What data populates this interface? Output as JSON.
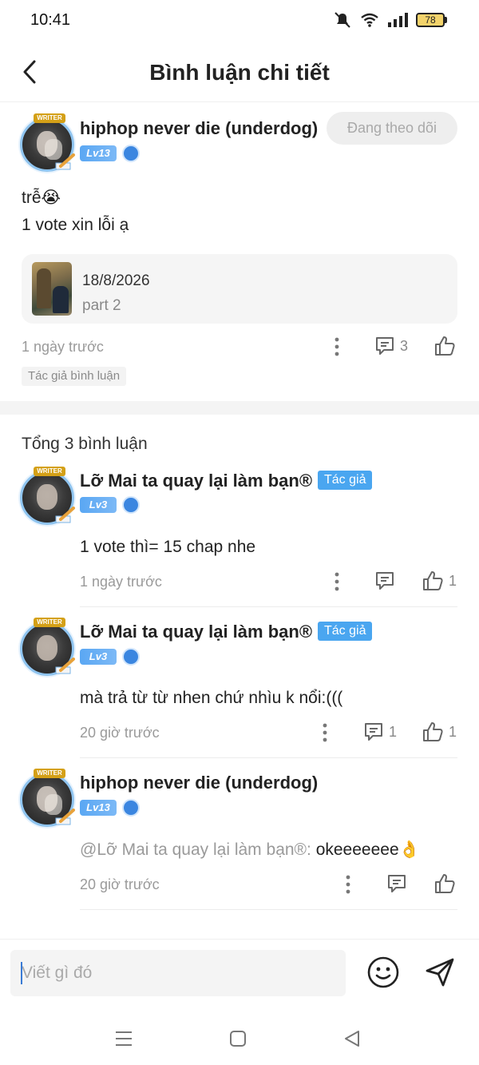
{
  "status_bar": {
    "time": "10:41",
    "battery": "78",
    "icons": [
      "mute-icon",
      "wifi-icon",
      "signal-icon",
      "battery-icon"
    ]
  },
  "header": {
    "title": "Bình luận chi tiết",
    "back_icon": "chevron-left-icon"
  },
  "main_comment": {
    "username": "hiphop never die (underdog)",
    "level": "Lv13",
    "follow_label": "Đang theo dõi",
    "text_line1": "trễ😭",
    "text_line2": "1 vote xin lỗi ạ",
    "chapter": {
      "date": "18/8/2026",
      "part": "part 2"
    },
    "time": "1 ngày trước",
    "reply_count": "3",
    "author_comment_tag": "Tác giả bình luận"
  },
  "replies_header": "Tổng 3 bình luận",
  "replies": [
    {
      "username": "Lỡ Mai ta quay lại làm bạn®",
      "level": "Lv3",
      "author_tag": "Tác giả",
      "text": "1 vote thì= 15 chap nhe",
      "time": "1 ngày trước",
      "reply_count": "",
      "like_count": "1"
    },
    {
      "username": "Lỡ Mai ta quay lại làm bạn®",
      "level": "Lv3",
      "author_tag": "Tác giả",
      "text": "mà trả từ từ nhen chứ nhìu k nổi:(((",
      "time": "20 giờ trước",
      "reply_count": "1",
      "like_count": "1"
    },
    {
      "username": "hiphop never die (underdog)",
      "level": "Lv13",
      "mention": "@Lỡ Mai ta quay lại làm bạn®:",
      "text": " okeeeeeee👌",
      "time": "20 giờ trước",
      "reply_count": "",
      "like_count": ""
    }
  ],
  "input": {
    "placeholder": "Viết gì đó"
  },
  "colors": {
    "accent_blue": "#4aa6f0",
    "level_badge": "#5aa7f3",
    "follow_bg": "#eeeeee",
    "muted_text": "#9a9a9a"
  }
}
